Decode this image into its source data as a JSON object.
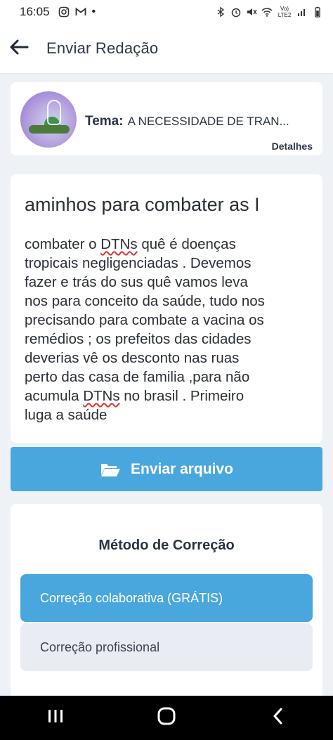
{
  "status_bar": {
    "time": "16:05",
    "dot": "•",
    "network_label": "Vo) LTE2",
    "icons": [
      "instagram-icon",
      "gmail-icon",
      "bluetooth-icon",
      "alarm-icon",
      "mute-icon",
      "wifi-icon",
      "signal-icon",
      "battery-icon"
    ]
  },
  "app_bar": {
    "back_icon": "arrow-left-icon",
    "title": "Enviar Redação"
  },
  "theme_card": {
    "label": "Tema:",
    "value": "A NECESSIDADE DE TRAN...",
    "details_link": "Detalhes"
  },
  "essay": {
    "title": "aminhos para combater as I",
    "lines": [
      {
        "before": "combater o ",
        "flag": "DTNs",
        "after": " quê é doenças"
      },
      {
        "before": "tropicais negligenciadas . Devemos",
        "flag": "",
        "after": ""
      },
      {
        "before": "fazer e trás do sus quê vamos leva",
        "flag": "",
        "after": ""
      },
      {
        "before": "nos para conceito da saúde,  tudo nos",
        "flag": "",
        "after": ""
      },
      {
        "before": "precisando para combate a vacina os",
        "flag": "",
        "after": ""
      },
      {
        "before": "remédios ; os prefeitos das cidades",
        "flag": "",
        "after": ""
      },
      {
        "before": "deverias vê os desconto nas ruas",
        "flag": "",
        "after": ""
      },
      {
        "before": "perto das casa de familia ,para não",
        "flag": "",
        "after": ""
      },
      {
        "before": "acumula ",
        "flag": "DTNs",
        "after": " no brasil . Primeiro"
      },
      {
        "before": "luga a saúde",
        "flag": "",
        "after": ""
      }
    ]
  },
  "send_button": {
    "icon": "folder-open-icon",
    "label": "Enviar arquivo"
  },
  "correction": {
    "title": "Método de Correção",
    "options": [
      {
        "label": "Correção colaborativa (GRÁTIS)",
        "selected": true
      },
      {
        "label": "Correção profissional",
        "selected": false
      }
    ]
  },
  "nav_bar": {
    "icons": [
      "recent-apps-icon",
      "home-icon",
      "back-icon"
    ]
  },
  "colors": {
    "accent": "#4aa7dd",
    "option_bg": "#e9ecf3",
    "page_bg": "#eef1f6",
    "text_dark": "#2b3443",
    "spell_underline": "#d33333"
  }
}
